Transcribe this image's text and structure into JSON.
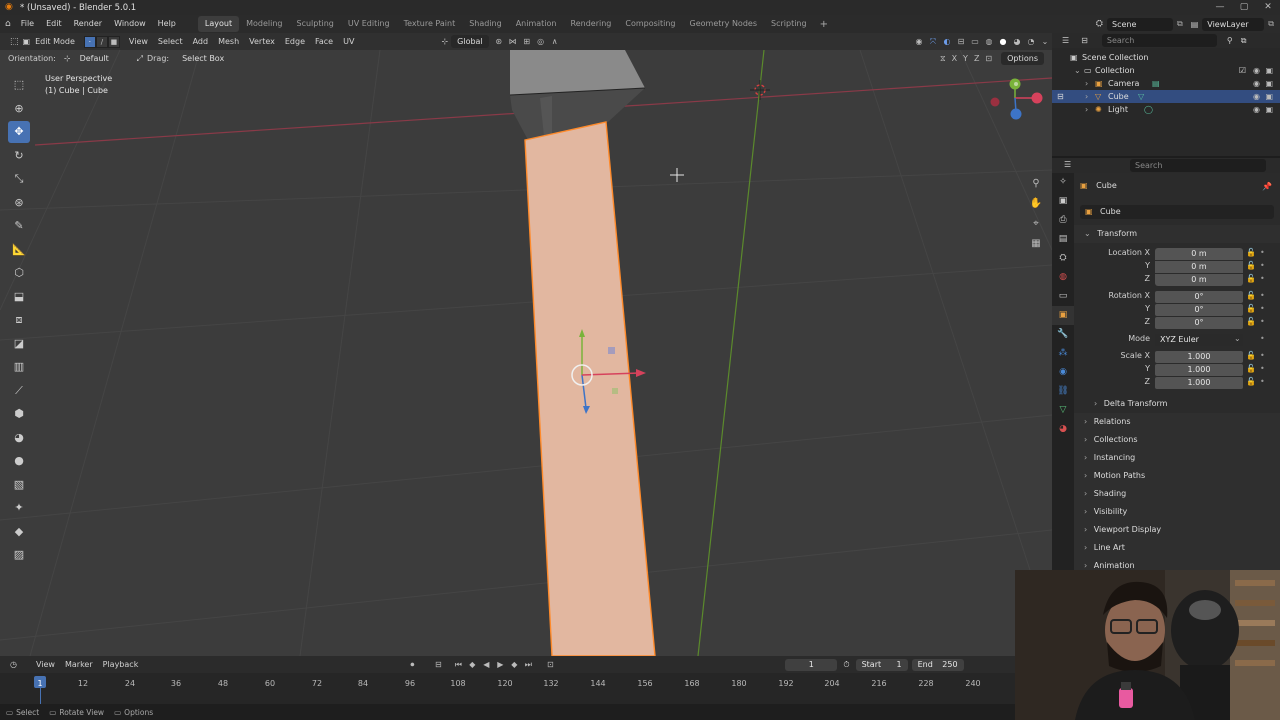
{
  "window": {
    "title": "* (Unsaved) - Blender 5.0.1",
    "controls": [
      "—",
      "▢",
      "✕"
    ]
  },
  "menu": [
    "File",
    "Edit",
    "Render",
    "Window",
    "Help"
  ],
  "workspaces": [
    "Layout",
    "Modeling",
    "Sculpting",
    "UV Editing",
    "Texture Paint",
    "Shading",
    "Animation",
    "Rendering",
    "Compositing",
    "Geometry Nodes",
    "Scripting"
  ],
  "active_workspace": "Layout",
  "scene": {
    "name": "Scene",
    "view_layer": "ViewLayer"
  },
  "viewport_header": {
    "mode": "Edit Mode",
    "menus": [
      "View",
      "Select",
      "Add",
      "Mesh",
      "Vertex",
      "Edge",
      "Face",
      "UV"
    ],
    "transform_orientation": "Global"
  },
  "tool_header": {
    "orientation_label": "Orientation:",
    "orientation_value": "Default",
    "drag_label": "Drag:",
    "drag_value": "Select Box",
    "options_label": "Options",
    "axes": [
      "X",
      "Y",
      "Z"
    ]
  },
  "viewport": {
    "view_name": "User Perspective",
    "object_info": "(1) Cube | Cube"
  },
  "outliner": {
    "search_placeholder": "Search",
    "root": "Scene Collection",
    "collection": "Collection",
    "items": [
      "Camera",
      "Cube",
      "Light"
    ],
    "selected": "Cube"
  },
  "properties": {
    "search_placeholder": "Search",
    "object_name": "Cube",
    "data_name": "Cube",
    "transform_title": "Transform",
    "location_label": "Location X",
    "location": [
      "0 m",
      "0 m",
      "0 m"
    ],
    "rotation_label": "Rotation X",
    "rotation": [
      "0°",
      "0°",
      "0°"
    ],
    "mode_label": "Mode",
    "mode_value": "XYZ Euler",
    "scale_label": "Scale X",
    "scale": [
      "1.000",
      "1.000",
      "1.000"
    ],
    "axis_y": "Y",
    "axis_z": "Z",
    "delta_transform": "Delta Transform",
    "sections": [
      "Relations",
      "Collections",
      "Instancing",
      "Motion Paths",
      "Shading",
      "Visibility",
      "Viewport Display",
      "Line Art",
      "Animation"
    ]
  },
  "timeline": {
    "menus": [
      "View",
      "Marker",
      "Playback"
    ],
    "current_frame": "1",
    "start_label": "Start",
    "start": "1",
    "end_label": "End",
    "end": "250",
    "ticks": [
      "1",
      "12",
      "24",
      "36",
      "48",
      "60",
      "72",
      "84",
      "96",
      "108",
      "120",
      "132",
      "144",
      "156",
      "168",
      "180",
      "192",
      "204",
      "216",
      "228",
      "240"
    ]
  },
  "statusbar": [
    "Select",
    "Rotate View",
    "Options"
  ],
  "colors": {
    "accent": "#4772b3",
    "selection_orange": "#ff8a2a",
    "face_fill": "#e8b8a0",
    "x_axis": "#d6425c",
    "y_axis": "#7ab33a",
    "z_axis": "#3d74c7"
  }
}
